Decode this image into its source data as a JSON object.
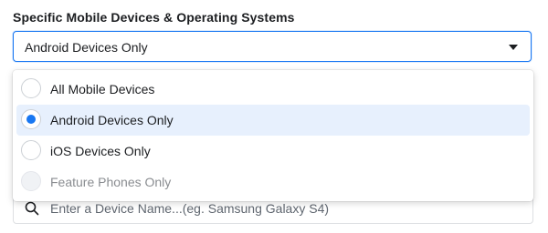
{
  "section": {
    "title": "Specific Mobile Devices & Operating Systems"
  },
  "select": {
    "value": "Android Devices Only",
    "icon": "caret-down-icon"
  },
  "dropdown": {
    "options": [
      {
        "label": "All Mobile Devices",
        "selected": false,
        "disabled": false
      },
      {
        "label": "Android Devices Only",
        "selected": true,
        "disabled": false
      },
      {
        "label": "iOS Devices Only",
        "selected": false,
        "disabled": false
      },
      {
        "label": "Feature Phones Only",
        "selected": false,
        "disabled": true
      }
    ]
  },
  "search": {
    "placeholder": "Enter a Device Name...(eg. Samsung Galaxy S4)",
    "icon": "search-icon"
  },
  "colors": {
    "accent": "#1877f2",
    "selected_bg": "#e7f0fd",
    "text": "#1c1e21",
    "muted_text": "#8a8d91"
  }
}
